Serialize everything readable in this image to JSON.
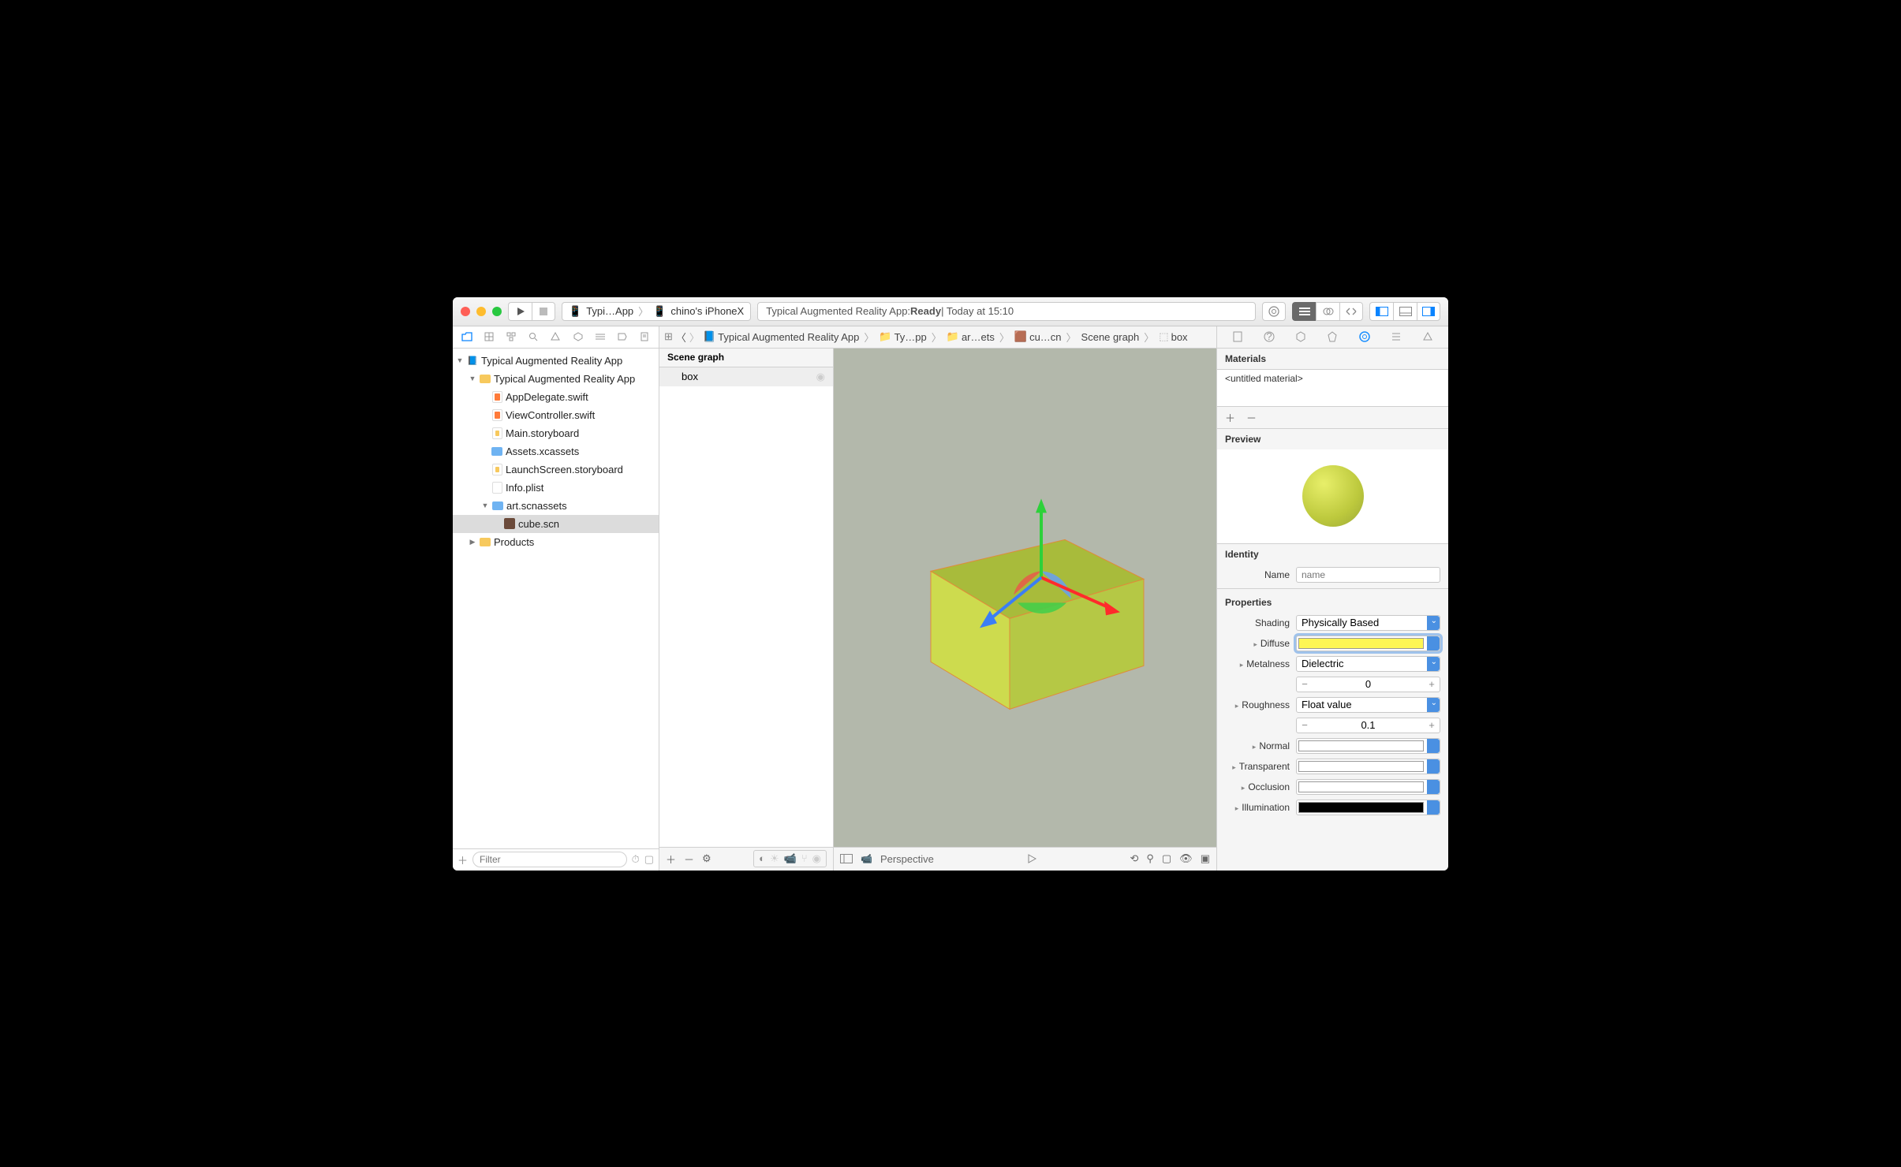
{
  "titlebar": {
    "scheme_app": "Typi…App",
    "scheme_device": "chino's iPhoneX",
    "status_prefix": "Typical Augmented Reality App: ",
    "status_state": "Ready",
    "status_suffix": " | Today at 15:10"
  },
  "navigator": {
    "project": "Typical Augmented Reality App",
    "group": "Typical Augmented Reality App",
    "files": {
      "appdelegate": "AppDelegate.swift",
      "viewcontroller": "ViewController.swift",
      "mainsb": "Main.storyboard",
      "assets": "Assets.xcassets",
      "launchsb": "LaunchScreen.storyboard",
      "info": "Info.plist",
      "scnassets": "art.scnassets",
      "cube": "cube.scn",
      "products": "Products"
    },
    "filter_placeholder": "Filter"
  },
  "jumpbar": {
    "project": "Typical Augmented Reality App",
    "group": "Ty…pp",
    "assets": "ar…ets",
    "scn": "cu…cn",
    "scene": "Scene graph",
    "node": "box"
  },
  "scene_graph": {
    "header": "Scene graph",
    "node": "box"
  },
  "viewport": {
    "camera_label": "Perspective"
  },
  "inspector": {
    "materials_header": "Materials",
    "material_name": "<untitled material>",
    "preview_header": "Preview",
    "identity_header": "Identity",
    "name_label": "Name",
    "name_placeholder": "name",
    "properties_header": "Properties",
    "shading_label": "Shading",
    "shading_value": "Physically Based",
    "diffuse_label": "Diffuse",
    "diffuse_color": "#fdf654",
    "metalness_label": "Metalness",
    "metalness_mode": "Dielectric",
    "metalness_value": "0",
    "roughness_label": "Roughness",
    "roughness_mode": "Float value",
    "roughness_value": "0.1",
    "normal_label": "Normal",
    "transparent_label": "Transparent",
    "occlusion_label": "Occlusion",
    "illumination_label": "Illumination"
  }
}
